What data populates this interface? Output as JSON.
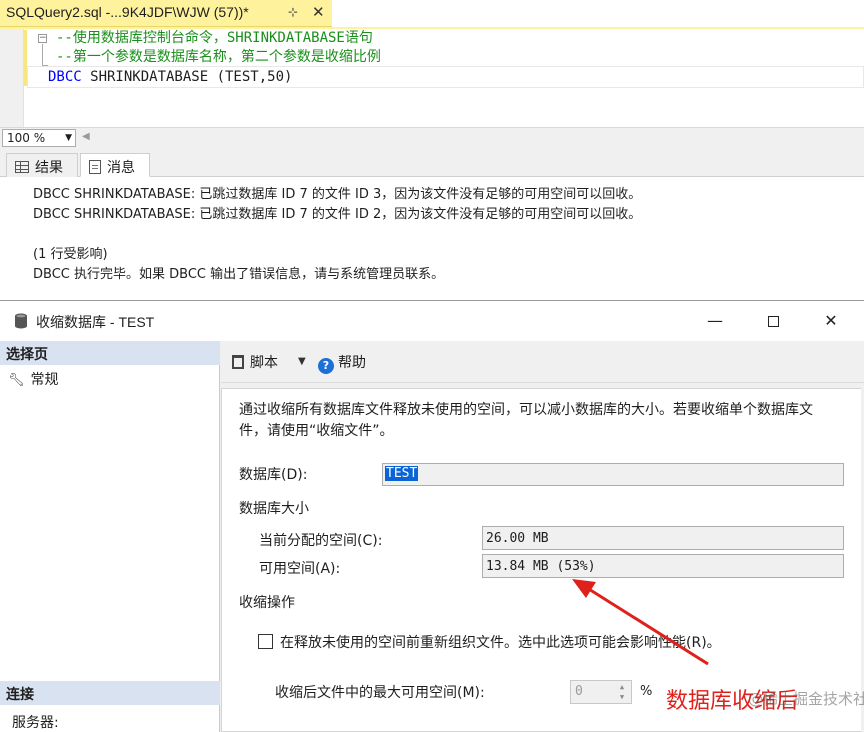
{
  "editor": {
    "tab_title": "SQLQuery2.sql -...9K4JDF\\WJW (57))*",
    "pin_glyph": "⊹",
    "close_glyph": "✕",
    "lines": {
      "comment1": "--使用数据库控制台命令，SHRINKDATABASE语句",
      "comment2": "--第一个参数是数据库名称，第二个参数是收缩比例",
      "keyword": "DBCC",
      "statement": " SHRINKDATABASE (TEST,50)"
    },
    "collapse_glyph": "−"
  },
  "zoom": {
    "value": "100 %"
  },
  "results": {
    "tabs": {
      "results": "结果",
      "messages": "消息"
    },
    "messages": [
      "DBCC SHRINKDATABASE: 已跳过数据库 ID 7 的文件 ID 3，因为该文件没有足够的可用空间可以回收。",
      "DBCC SHRINKDATABASE: 已跳过数据库 ID 7 的文件 ID 2，因为该文件没有足够的可用空间可以回收。",
      "(1 行受影响)",
      "DBCC 执行完毕。如果 DBCC 输出了错误信息，请与系统管理员联系。"
    ]
  },
  "dialog": {
    "title": "收缩数据库 - TEST",
    "left_pane": {
      "select_page": "选择页",
      "general": "常规",
      "connect": "连接",
      "server": "服务器:"
    },
    "toolbar": {
      "script": "脚本",
      "help": "帮助"
    },
    "description": "通过收缩所有数据库文件释放未使用的空间，可以减小数据库的大小。若要收缩单个数据库文件，请使用“收缩文件”。",
    "database_label": "数据库(D):",
    "database_value": "TEST",
    "db_size_label": "数据库大小",
    "allocated_label": "当前分配的空间(C):",
    "allocated_value": "26.00 MB",
    "available_label": "可用空间(A):",
    "available_value": "13.84 MB (53%)",
    "shrink_op_label": "收缩操作",
    "reorganize_label": "在释放未使用的空间前重新组织文件。选中此选项可能会影响性能(R)。",
    "reorganize_checked": false,
    "max_free_label": "收缩后文件中的最大可用空间(M):",
    "max_free_value": "0",
    "percent": "%"
  },
  "annotation": {
    "text": "数据库收缩后",
    "color": "#e0201b"
  },
  "watermark": "@稀土掘金技术社区",
  "colors": {
    "tab_yellow": "#fff29d",
    "pane_header": "#d9e2f0",
    "selection_blue": "#0a64d6",
    "comment_green": "#1b8f1b",
    "keyword_blue": "#0000ff"
  }
}
